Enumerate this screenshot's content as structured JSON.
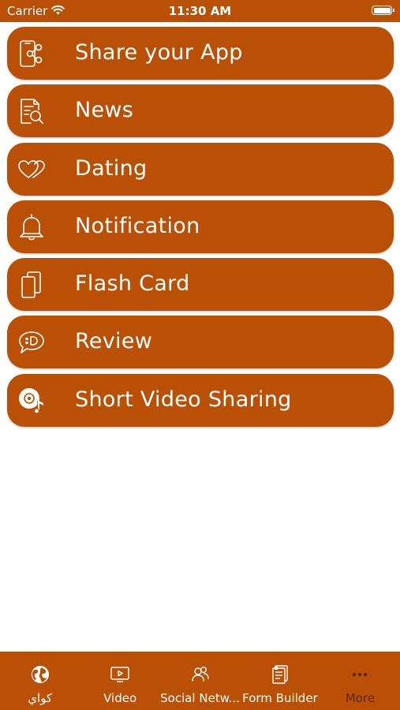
{
  "status_bar": {
    "carrier": "Carrier",
    "time": "11:30 AM",
    "wifi_icon": "wifi-icon",
    "battery_icon": "battery-icon"
  },
  "theme": {
    "brand_color": "#b95006",
    "background": "#ffffff",
    "text_color": "#ffffff",
    "more_tab_color": "#5a2a0a"
  },
  "menu": {
    "items": [
      {
        "label": "Share your App",
        "icon": "share-app-icon"
      },
      {
        "label": "News",
        "icon": "news-icon"
      },
      {
        "label": "Dating",
        "icon": "hearts-icon"
      },
      {
        "label": "Notification",
        "icon": "bell-icon"
      },
      {
        "label": "Flash Card",
        "icon": "flash-card-icon"
      },
      {
        "label": "Review",
        "icon": "review-icon"
      },
      {
        "label": "Short Video Sharing",
        "icon": "music-disc-icon"
      }
    ]
  },
  "tab_bar": {
    "tabs": [
      {
        "label": "كواي",
        "icon": "globe-icon"
      },
      {
        "label": "Video",
        "icon": "video-icon"
      },
      {
        "label": "Social Netw...",
        "icon": "users-icon"
      },
      {
        "label": "Form Builder",
        "icon": "form-icon"
      },
      {
        "label": "More",
        "icon": "more-icon"
      }
    ]
  }
}
